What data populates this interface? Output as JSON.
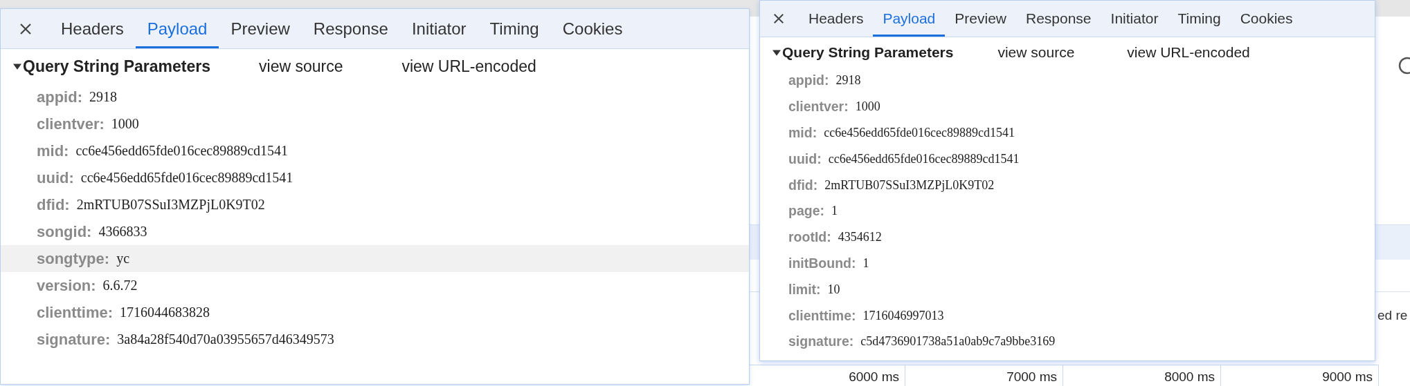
{
  "background": {
    "text_fragment": "ed re",
    "timeline_ticks": [
      "6000 ms",
      "7000 ms",
      "8000 ms",
      "9000 ms"
    ]
  },
  "panels": [
    {
      "tabs": [
        {
          "label": "Headers",
          "selected": false
        },
        {
          "label": "Payload",
          "selected": true
        },
        {
          "label": "Preview",
          "selected": false
        },
        {
          "label": "Response",
          "selected": false
        },
        {
          "label": "Initiator",
          "selected": false
        },
        {
          "label": "Timing",
          "selected": false
        },
        {
          "label": "Cookies",
          "selected": false
        }
      ],
      "section": {
        "title": "Query String Parameters",
        "expanded": true,
        "links": [
          "view source",
          "view URL-encoded"
        ]
      },
      "params": [
        {
          "key": "appid:",
          "value": "2918",
          "highlighted": false
        },
        {
          "key": "clientver:",
          "value": "1000",
          "highlighted": false
        },
        {
          "key": "mid:",
          "value": "cc6e456edd65fde016cec89889cd1541",
          "highlighted": false
        },
        {
          "key": "uuid:",
          "value": "cc6e456edd65fde016cec89889cd1541",
          "highlighted": false
        },
        {
          "key": "dfid:",
          "value": "2mRTUB07SSuI3MZPjL0K9T02",
          "highlighted": false
        },
        {
          "key": "songid:",
          "value": "4366833",
          "highlighted": false
        },
        {
          "key": "songtype:",
          "value": "yc",
          "highlighted": true
        },
        {
          "key": "version:",
          "value": "6.6.72",
          "highlighted": false
        },
        {
          "key": "clienttime:",
          "value": "1716044683828",
          "highlighted": false
        },
        {
          "key": "signature:",
          "value": "3a84a28f540d70a03955657d46349573",
          "highlighted": false
        }
      ]
    },
    {
      "tabs": [
        {
          "label": "Headers",
          "selected": false
        },
        {
          "label": "Payload",
          "selected": true
        },
        {
          "label": "Preview",
          "selected": false
        },
        {
          "label": "Response",
          "selected": false
        },
        {
          "label": "Initiator",
          "selected": false
        },
        {
          "label": "Timing",
          "selected": false
        },
        {
          "label": "Cookies",
          "selected": false
        }
      ],
      "section": {
        "title": "Query String Parameters",
        "expanded": true,
        "links": [
          "view source",
          "view URL-encoded"
        ]
      },
      "params": [
        {
          "key": "appid:",
          "value": "2918",
          "highlighted": false
        },
        {
          "key": "clientver:",
          "value": "1000",
          "highlighted": false
        },
        {
          "key": "mid:",
          "value": "cc6e456edd65fde016cec89889cd1541",
          "highlighted": false
        },
        {
          "key": "uuid:",
          "value": "cc6e456edd65fde016cec89889cd1541",
          "highlighted": false
        },
        {
          "key": "dfid:",
          "value": "2mRTUB07SSuI3MZPjL0K9T02",
          "highlighted": false
        },
        {
          "key": "page:",
          "value": "1",
          "highlighted": false
        },
        {
          "key": "rootId:",
          "value": "4354612",
          "highlighted": false
        },
        {
          "key": "initBound:",
          "value": "1",
          "highlighted": false
        },
        {
          "key": "limit:",
          "value": "10",
          "highlighted": false
        },
        {
          "key": "clienttime:",
          "value": "1716046997013",
          "highlighted": false
        },
        {
          "key": "signature:",
          "value": "c5d4736901738a51a0ab9c7a9bbe3169",
          "highlighted": false
        }
      ]
    }
  ]
}
